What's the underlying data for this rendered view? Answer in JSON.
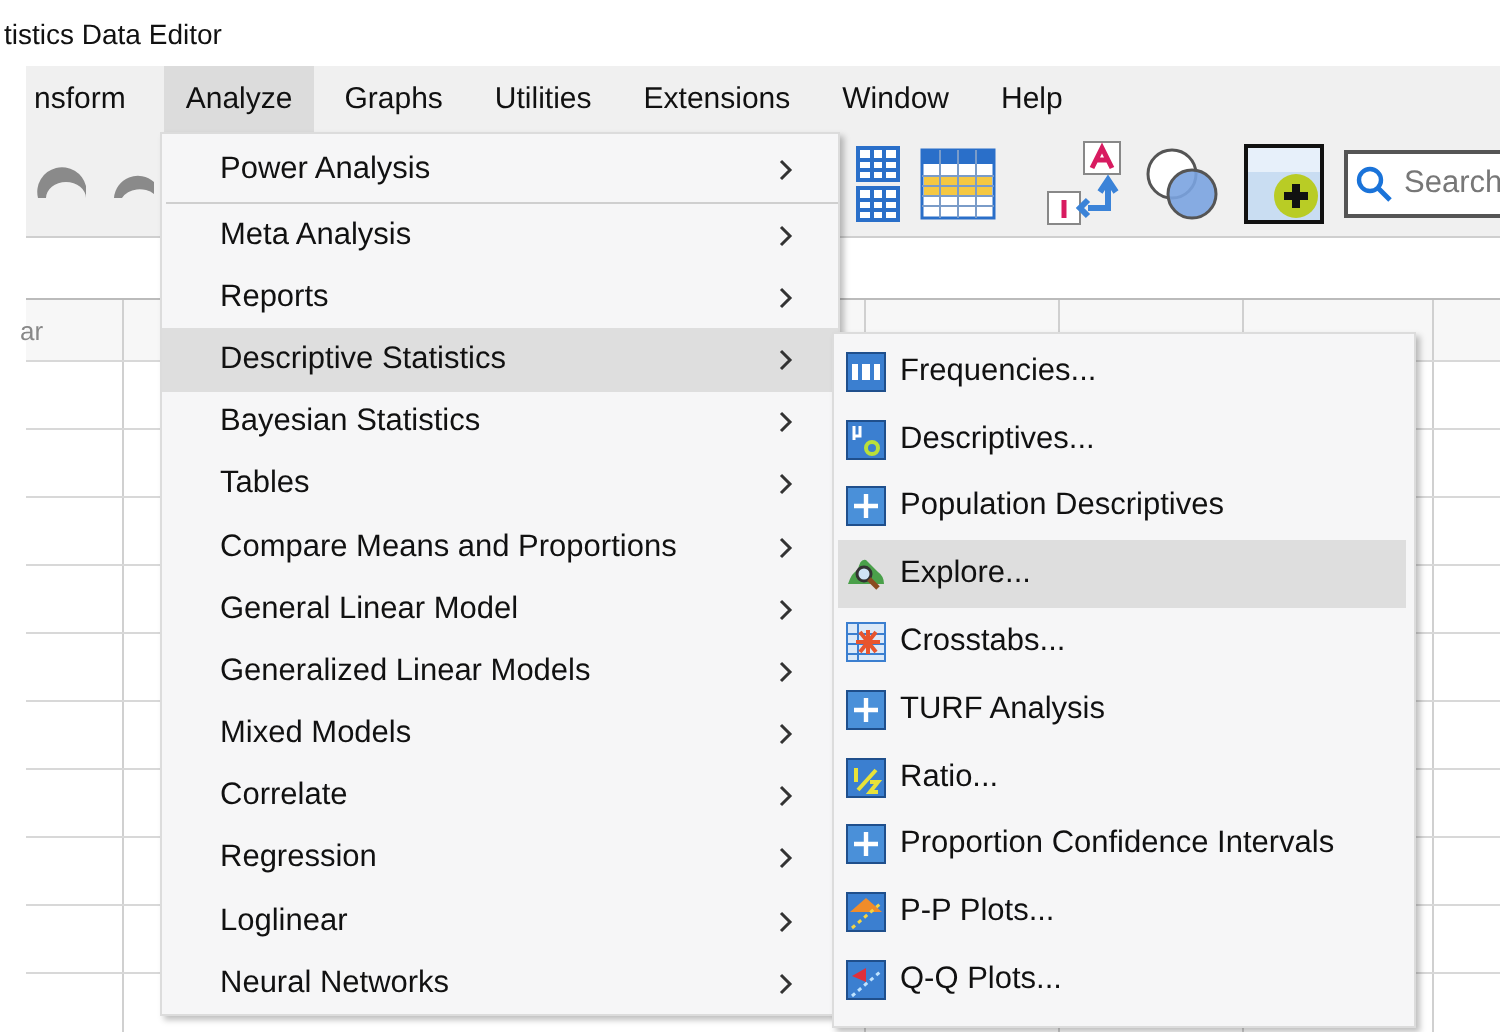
{
  "window": {
    "title": "tistics Data Editor"
  },
  "menubar": [
    {
      "label": "nsform",
      "selected": false
    },
    {
      "label": "Analyze",
      "selected": true
    },
    {
      "label": "Graphs",
      "selected": false
    },
    {
      "label": "Utilities",
      "selected": false
    },
    {
      "label": "Extensions",
      "selected": false
    },
    {
      "label": "Window",
      "selected": false
    },
    {
      "label": "Help",
      "selected": false
    }
  ],
  "toolbar": {
    "search": {
      "placeholder": "Search"
    }
  },
  "grid": {
    "columns": [
      "ar"
    ]
  },
  "analyze_menu": {
    "items": [
      {
        "label": "Power Analysis",
        "selected": false,
        "separator_after": true
      },
      {
        "label": "Meta Analysis",
        "selected": false,
        "separator_after": false
      },
      {
        "label": "Reports",
        "selected": false,
        "separator_after": false
      },
      {
        "label": "Descriptive Statistics",
        "selected": true,
        "separator_after": false
      },
      {
        "label": "Bayesian Statistics",
        "selected": false,
        "separator_after": false
      },
      {
        "label": "Tables",
        "selected": false,
        "separator_after": false
      },
      {
        "label": "Compare Means and Proportions",
        "selected": false,
        "separator_after": false
      },
      {
        "label": "General Linear Model",
        "selected": false,
        "separator_after": false
      },
      {
        "label": "Generalized Linear Models",
        "selected": false,
        "separator_after": false
      },
      {
        "label": "Mixed Models",
        "selected": false,
        "separator_after": false
      },
      {
        "label": "Correlate",
        "selected": false,
        "separator_after": false
      },
      {
        "label": "Regression",
        "selected": false,
        "separator_after": false
      },
      {
        "label": "Loglinear",
        "selected": false,
        "separator_after": false
      },
      {
        "label": "Neural Networks",
        "selected": false,
        "separator_after": false
      }
    ]
  },
  "submenu": {
    "items": [
      {
        "label": "Frequencies...",
        "kind": "frequencies",
        "selected": false
      },
      {
        "label": "Descriptives...",
        "kind": "descriptives",
        "selected": false
      },
      {
        "label": "Population Descriptives",
        "kind": "plus",
        "selected": false
      },
      {
        "label": "Explore...",
        "kind": "explore",
        "selected": true
      },
      {
        "label": "Crosstabs...",
        "kind": "crosstabs",
        "selected": false
      },
      {
        "label": "TURF Analysis",
        "kind": "plus",
        "selected": false
      },
      {
        "label": "Ratio...",
        "kind": "ratio",
        "selected": false
      },
      {
        "label": "Proportion Confidence Intervals",
        "kind": "plus",
        "selected": false
      },
      {
        "label": "P-P Plots...",
        "kind": "pp",
        "selected": false
      },
      {
        "label": "Q-Q Plots...",
        "kind": "qq",
        "selected": false
      }
    ]
  }
}
